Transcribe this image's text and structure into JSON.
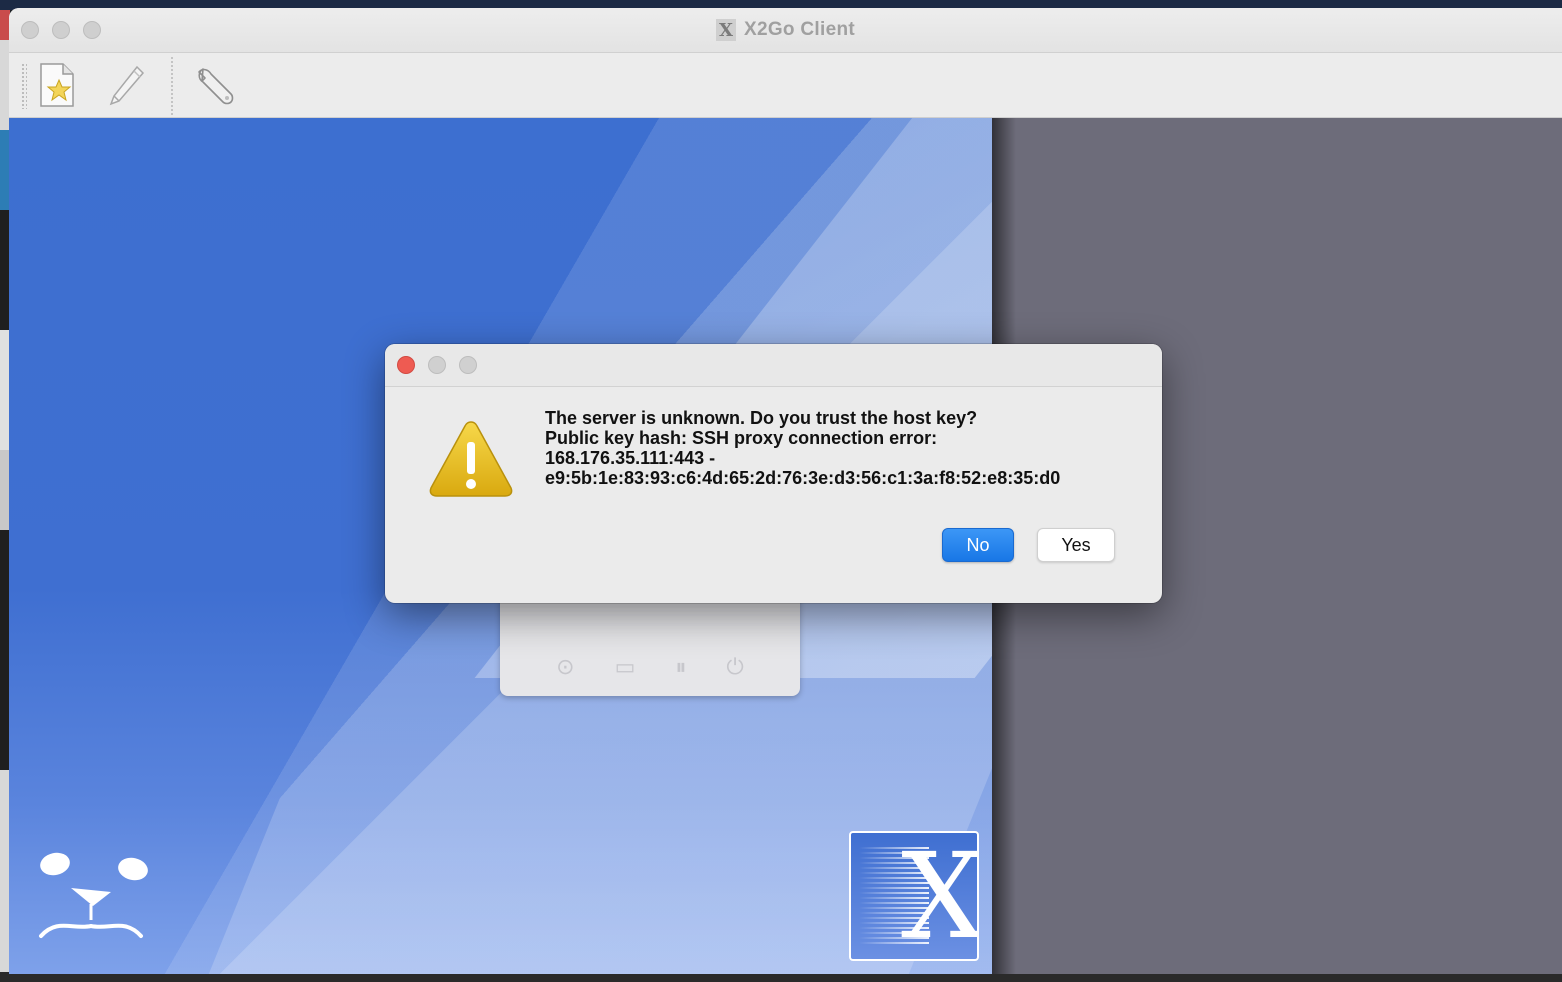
{
  "window": {
    "title": "X2Go Client",
    "title_icon": "x2go-app-icon"
  },
  "toolbar": {
    "items": [
      {
        "name": "new-session",
        "icon": "new-document-star-icon"
      },
      {
        "name": "edit-session",
        "icon": "pencil-icon"
      },
      {
        "name": "preferences",
        "icon": "wrench-icon"
      }
    ]
  },
  "dialog": {
    "message_lines": [
      "The server is unknown. Do you trust the host key?",
      "Public key hash: SSH proxy connection error:",
      "168.176.35.111:443 -",
      "e9:5b:1e:83:93:c6:4d:65:2d:76:3e:d3:56:c1:3a:f8:52:e8:35:d0"
    ],
    "icon": "warning-icon",
    "buttons": {
      "no_label": "No",
      "yes_label": "Yes"
    }
  },
  "session_card": {
    "icons": [
      "circle-icon",
      "folder-icon",
      "pause-icon",
      "power-icon"
    ]
  },
  "colors": {
    "accent_button": "#1e7ff0",
    "background_blue": "#3f6fd1",
    "right_panel": "#6d6c7a",
    "close_red": "#ee5b52",
    "warning_yellow": "#f0c419"
  }
}
